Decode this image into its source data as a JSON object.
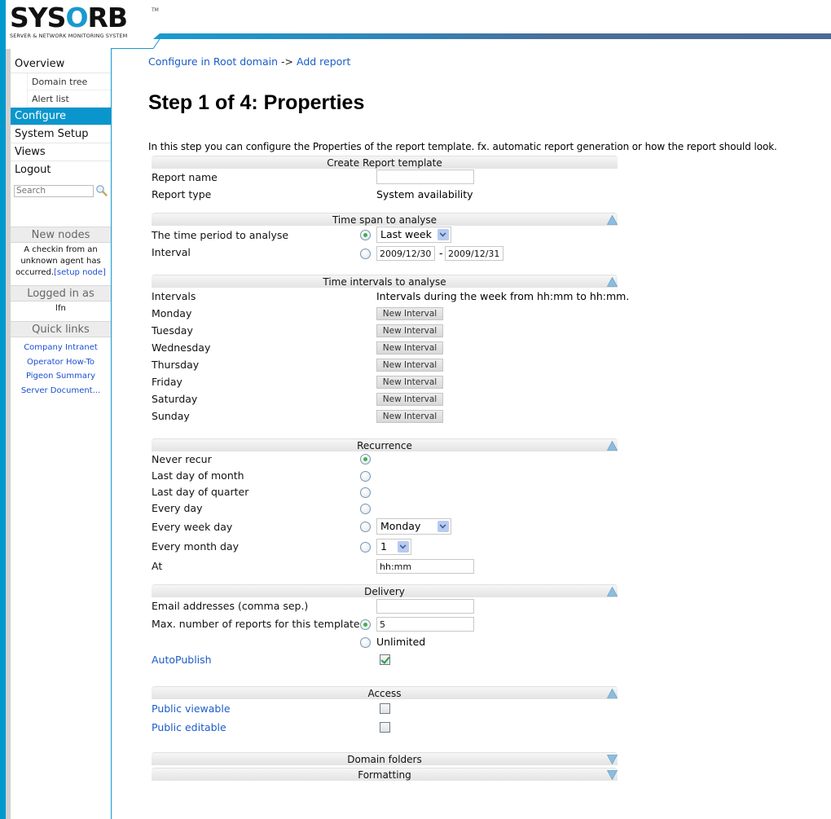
{
  "header": {
    "logo_prefix": "SYS",
    "logo_o": "O",
    "logo_suffix": "RB",
    "logo_tm": "TM",
    "logo_subtitle": "SERVER & NETWORK MONITORING SYSTEM",
    "colors": {
      "accent": "#1899cf",
      "nav_active": "#0a96cc",
      "bar_end": "#4a6a95"
    }
  },
  "sidebar": {
    "nav": [
      {
        "label": "Overview"
      },
      {
        "label": "Domain tree"
      },
      {
        "label": "Alert list"
      },
      {
        "label": "Configure",
        "active": true
      },
      {
        "label": "System Setup"
      },
      {
        "label": "Views"
      },
      {
        "label": "Logout"
      }
    ],
    "search_placeholder": "Search",
    "search_icon": "magnifier-icon",
    "new_nodes": {
      "title": "New nodes",
      "text": "A checkin from an unknown agent has occurred.",
      "link": "[setup node]"
    },
    "logged_in": {
      "title": "Logged in as",
      "user": "lfn"
    },
    "quick_links": {
      "title": "Quick links",
      "items": [
        "Company Intranet",
        "Operator How-To",
        "Pigeon Summary",
        "Server Document..."
      ]
    }
  },
  "main": {
    "breadcrumb": {
      "part1": "Configure in Root domain",
      "sep": "->",
      "part2": "Add report"
    },
    "title": "Step 1 of 4: Properties",
    "intro": "In this step you can configure the Properties of the report template. fx. automatic report generation or how the report should look.",
    "sections": {
      "create": {
        "title": "Create Report template",
        "report_name_label": "Report name",
        "report_name_value": "",
        "report_type_label": "Report type",
        "report_type_value": "System availability"
      },
      "timespan": {
        "title": "Time span to analyse",
        "period_label": "The time period to analyse",
        "period_selected": true,
        "period_value": "Last week",
        "interval_label": "Interval",
        "interval_selected": false,
        "interval_from": "2009/12/30",
        "interval_sep": "-",
        "interval_to": "2009/12/31"
      },
      "intervals": {
        "title": "Time intervals to analyse",
        "intervals_label": "Intervals",
        "intervals_desc": "Intervals during the week from hh:mm to hh:mm.",
        "button_label": "New Interval",
        "days": [
          "Monday",
          "Tuesday",
          "Wednesday",
          "Thursday",
          "Friday",
          "Saturday",
          "Sunday"
        ]
      },
      "recurrence": {
        "title": "Recurrence",
        "options": [
          {
            "label": "Never recur",
            "selected": true
          },
          {
            "label": "Last day of month",
            "selected": false
          },
          {
            "label": "Last day of quarter",
            "selected": false
          },
          {
            "label": "Every day",
            "selected": false
          },
          {
            "label": "Every week day",
            "selected": false
          },
          {
            "label": "Every month day",
            "selected": false
          }
        ],
        "week_day_value": "Monday",
        "month_day_value": "1",
        "at_label": "At",
        "at_value": "hh:mm"
      },
      "delivery": {
        "title": "Delivery",
        "email_label": "Email addresses (comma sep.)",
        "email_value": "",
        "max_label": "Max. number of reports for this template",
        "max_selected": true,
        "max_value": "5",
        "unlimited_label": "Unlimited",
        "unlimited_selected": false,
        "autopublish_label": "AutoPublish",
        "autopublish_checked": true
      },
      "access": {
        "title": "Access",
        "public_viewable_label": "Public viewable",
        "public_viewable_checked": false,
        "public_editable_label": "Public editable",
        "public_editable_checked": false
      },
      "domain_folders": {
        "title": "Domain folders",
        "collapsed": true
      },
      "formatting": {
        "title": "Formatting",
        "collapsed": true
      }
    }
  }
}
